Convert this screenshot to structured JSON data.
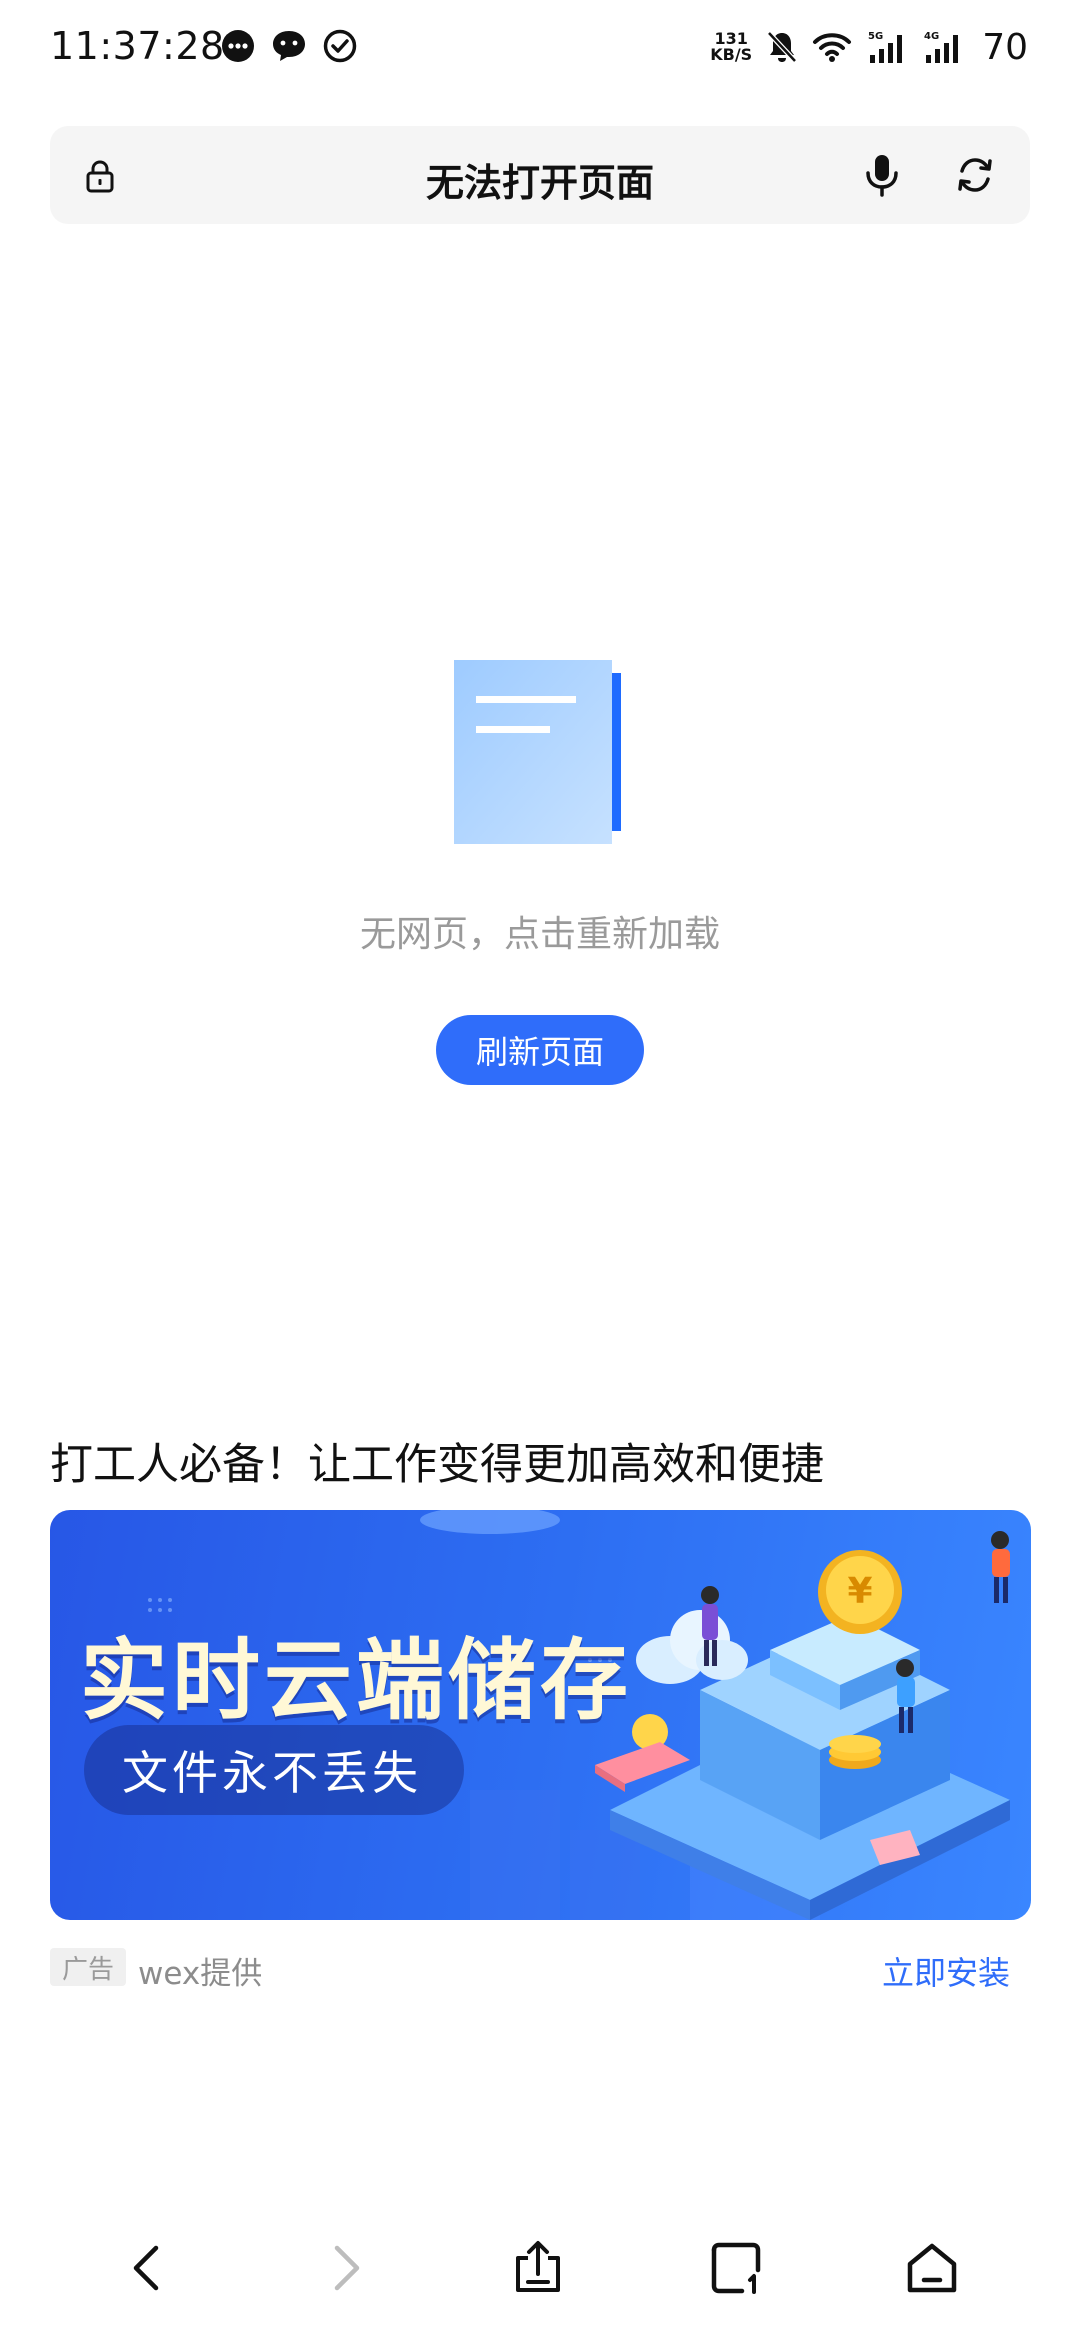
{
  "status_bar": {
    "time": "11:37:28",
    "net_speed_value": "131",
    "net_speed_unit": "KB/S",
    "signal_1_label": "5G",
    "signal_2_label": "4G",
    "battery": "70",
    "icons": [
      "message-bubble-icon",
      "chat-icon",
      "check-circle-icon",
      "bell-muted-icon",
      "wifi-icon",
      "signal-icon"
    ]
  },
  "address_bar": {
    "title": "无法打开页面",
    "icons": [
      "lock-icon",
      "microphone-icon",
      "refresh-icon"
    ]
  },
  "empty_state": {
    "message": "无网页，点击重新加载",
    "button_label": "刷新页面"
  },
  "ad": {
    "headline": "打工人必备！让工作变得更加高效和便捷",
    "banner_title": "实时云端储存",
    "banner_subtitle": "文件永不丢失",
    "tag": "广告",
    "provider": "wex提供",
    "install_label": "立即安装"
  },
  "bottom_nav": {
    "icons": [
      "back-arrow-icon",
      "forward-arrow-icon",
      "share-icon",
      "tabs-icon",
      "home-icon"
    ]
  },
  "colors": {
    "accent": "#2f6dfa",
    "muted_text": "#9a9a9a",
    "address_bar_bg": "#f5f5f5"
  }
}
